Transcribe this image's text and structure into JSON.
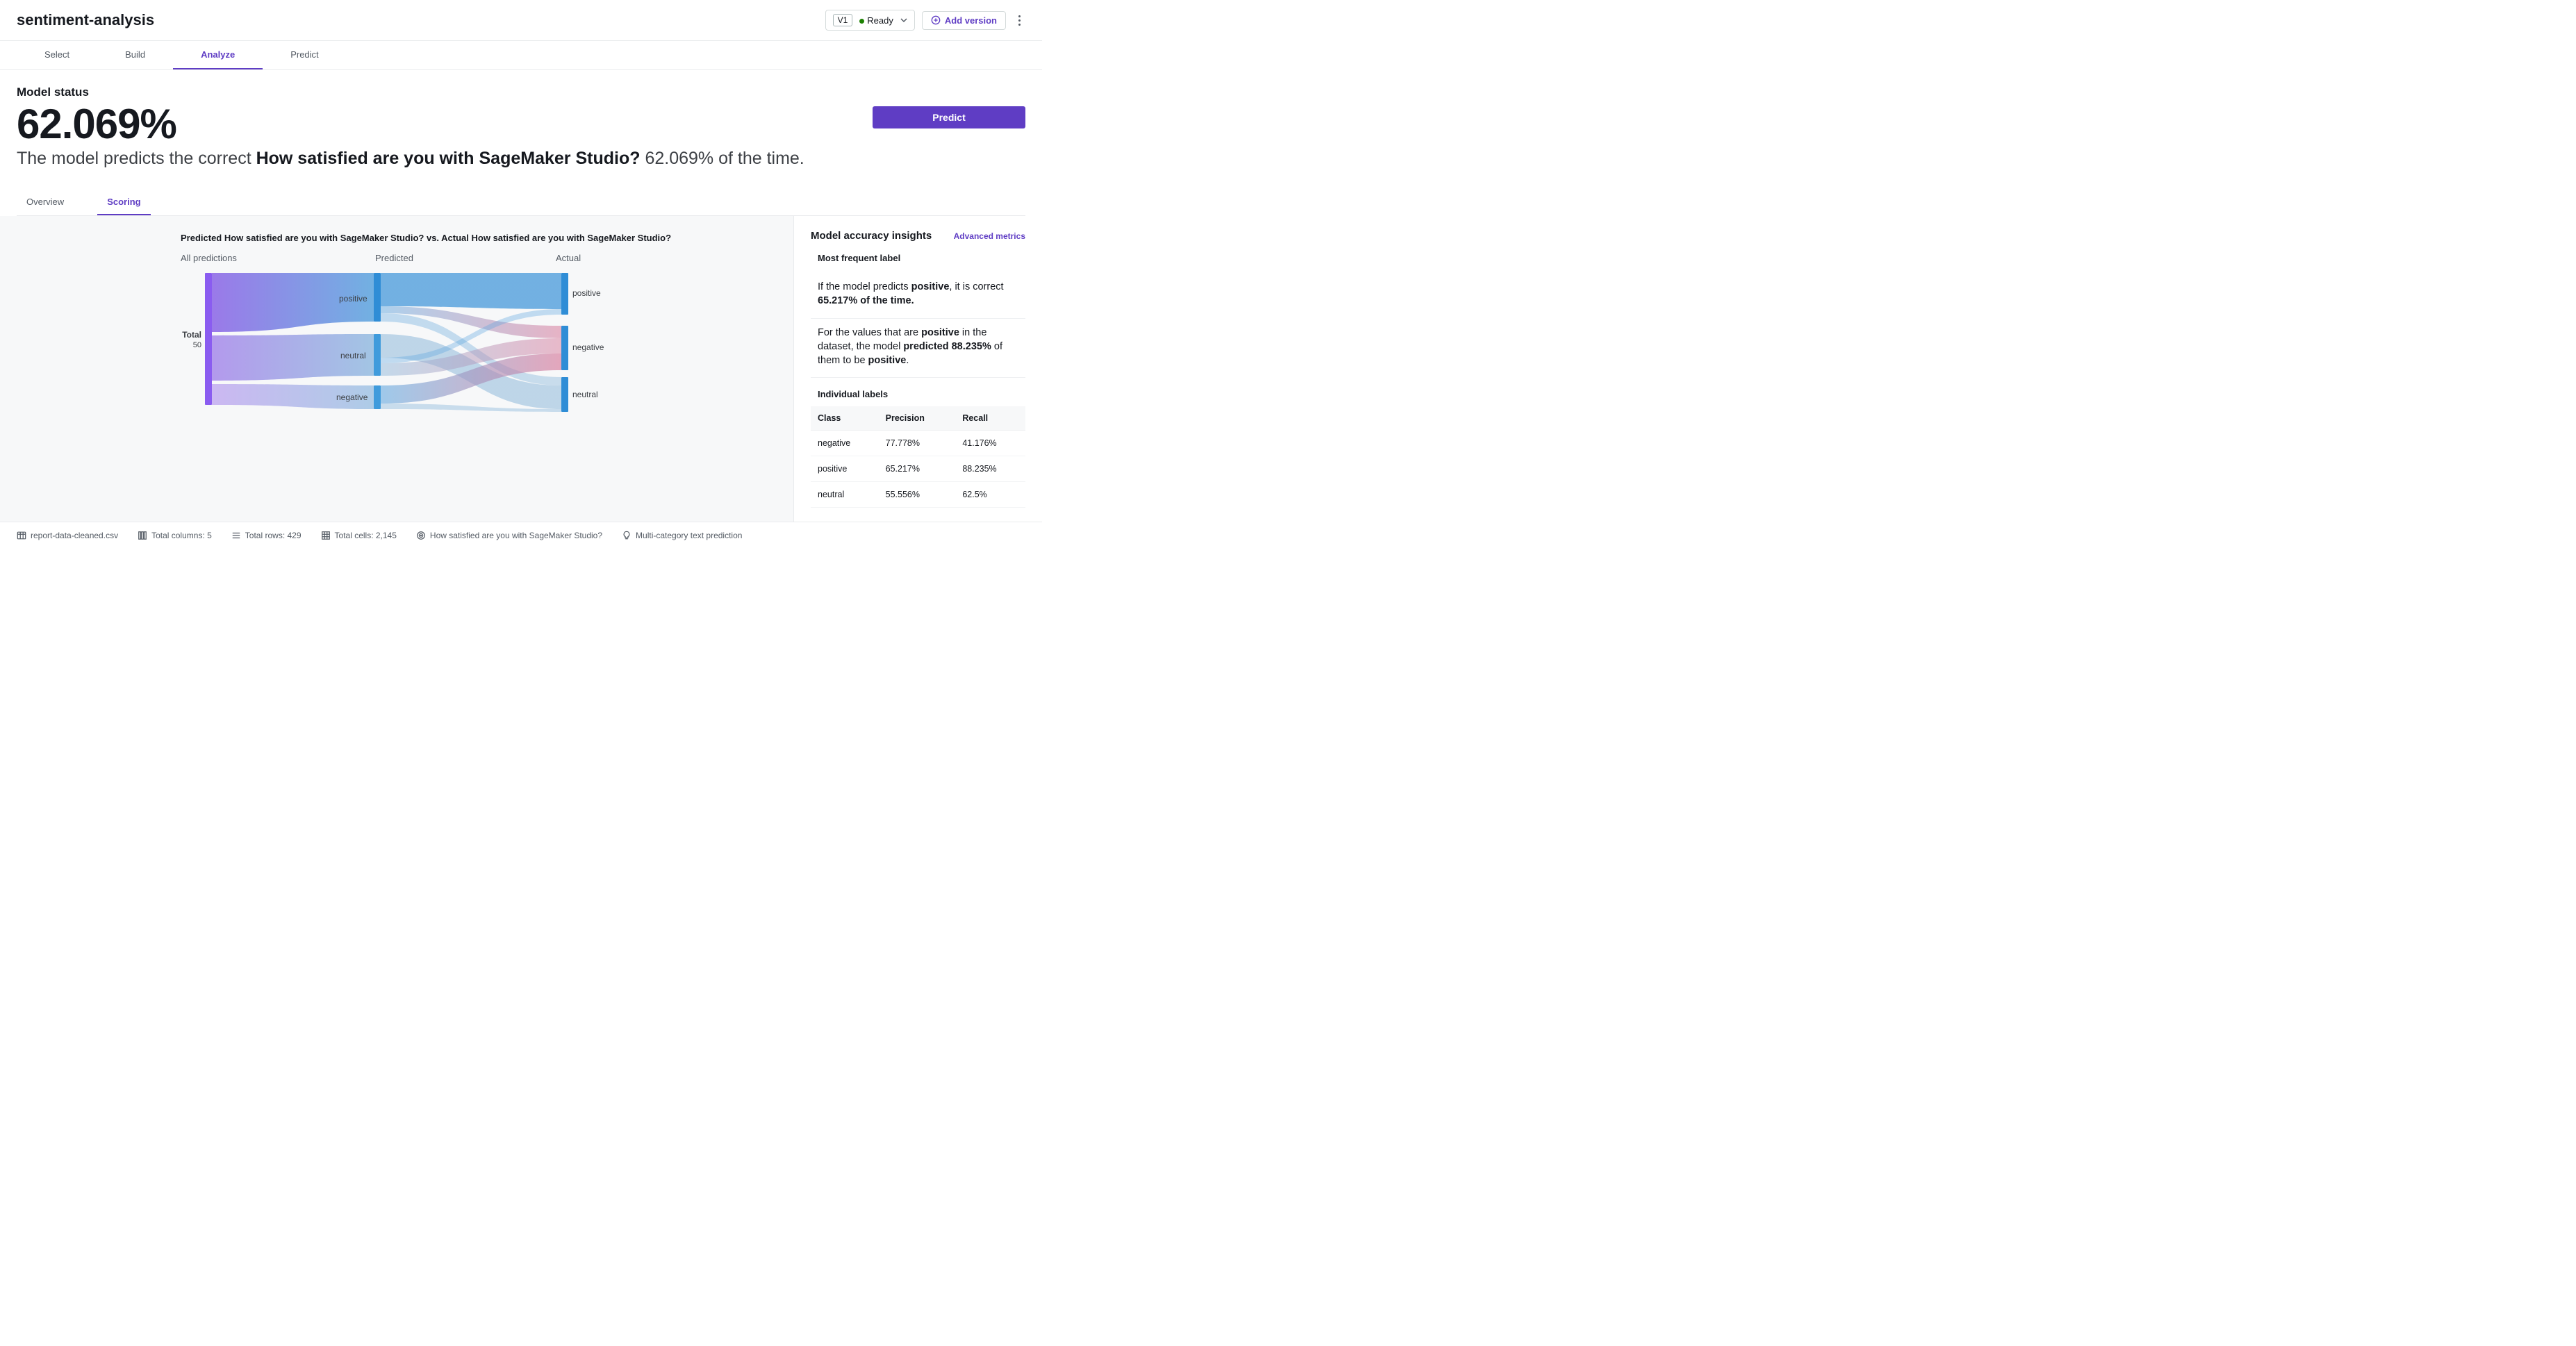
{
  "header": {
    "title": "sentiment-analysis",
    "version_label": "V1",
    "status_label": "Ready",
    "add_version_label": "Add version"
  },
  "main_tabs": [
    "Select",
    "Build",
    "Analyze",
    "Predict"
  ],
  "main_tab_active": "Analyze",
  "model_status": {
    "label": "Model status",
    "percent": "62.069%",
    "sentence_prefix": "The model predicts the correct ",
    "sentence_bold": "How satisfied are you with SageMaker Studio?",
    "sentence_suffix": " 62.069% of the time.",
    "predict_button": "Predict"
  },
  "sub_tabs": [
    "Overview",
    "Scoring"
  ],
  "sub_tab_active": "Scoring",
  "chart": {
    "title": "Predicted How satisfied are you with SageMaker Studio? vs. Actual How satisfied are you with SageMaker Studio?",
    "col_headers": [
      "All predictions",
      "Predicted",
      "Actual"
    ],
    "total_label": "Total",
    "total_value": "50"
  },
  "chart_data": {
    "type": "sankey",
    "stages": [
      {
        "name": "Total",
        "nodes": [
          {
            "label": "Total",
            "value": 50
          }
        ]
      },
      {
        "name": "Predicted",
        "nodes": [
          {
            "label": "positive",
            "value": 23
          },
          {
            "label": "neutral",
            "value": 18
          },
          {
            "label": "negative",
            "value": 9
          }
        ]
      },
      {
        "name": "Actual",
        "nodes": [
          {
            "label": "positive",
            "value": 17
          },
          {
            "label": "negative",
            "value": 17
          },
          {
            "label": "neutral",
            "value": 16
          }
        ]
      }
    ],
    "flows_total_to_predicted": [
      {
        "to": "positive",
        "value": 23
      },
      {
        "to": "neutral",
        "value": 18
      },
      {
        "to": "negative",
        "value": 9
      }
    ],
    "flows_predicted_to_actual": [
      {
        "from": "positive",
        "to": "positive",
        "value": 15
      },
      {
        "from": "positive",
        "to": "negative",
        "value": 5
      },
      {
        "from": "positive",
        "to": "neutral",
        "value": 3
      },
      {
        "from": "neutral",
        "to": "neutral",
        "value": 10
      },
      {
        "from": "neutral",
        "to": "positive",
        "value": 2
      },
      {
        "from": "neutral",
        "to": "negative",
        "value": 6
      },
      {
        "from": "negative",
        "to": "negative",
        "value": 7
      },
      {
        "from": "negative",
        "to": "neutral",
        "value": 2
      }
    ],
    "colors": {
      "positive": "#3f9bdc",
      "neutral": "#7aa8d6",
      "negative": "#d55b84",
      "total": "#8a63e6"
    }
  },
  "insights": {
    "panel_title": "Model accuracy insights",
    "advanced_link": "Advanced metrics",
    "most_frequent_title": "Most frequent label",
    "p1_pre": "If the model predicts ",
    "p1_b1": "positive",
    "p1_mid": ", it is correct ",
    "p1_b2": "65.217% of the time.",
    "p2_pre": "For the values that are ",
    "p2_b1": "positive",
    "p2_mid": " in the dataset, the model ",
    "p2_b2": "predicted 88.235%",
    "p2_mid2": " of them to be ",
    "p2_b3": "positive",
    "p2_end": ".",
    "individual_title": "Individual labels",
    "table_headers": [
      "Class",
      "Precision",
      "Recall"
    ],
    "table_rows": [
      {
        "class": "negative",
        "precision": "77.778%",
        "recall": "41.176%"
      },
      {
        "class": "positive",
        "precision": "65.217%",
        "recall": "88.235%"
      },
      {
        "class": "neutral",
        "precision": "55.556%",
        "recall": "62.5%"
      }
    ]
  },
  "footer": {
    "file": "report-data-cleaned.csv",
    "cols": "Total columns: 5",
    "rows": "Total rows: 429",
    "cells": "Total cells: 2,145",
    "target": "How satisfied are you with SageMaker Studio?",
    "model_type": "Multi-category text prediction"
  }
}
